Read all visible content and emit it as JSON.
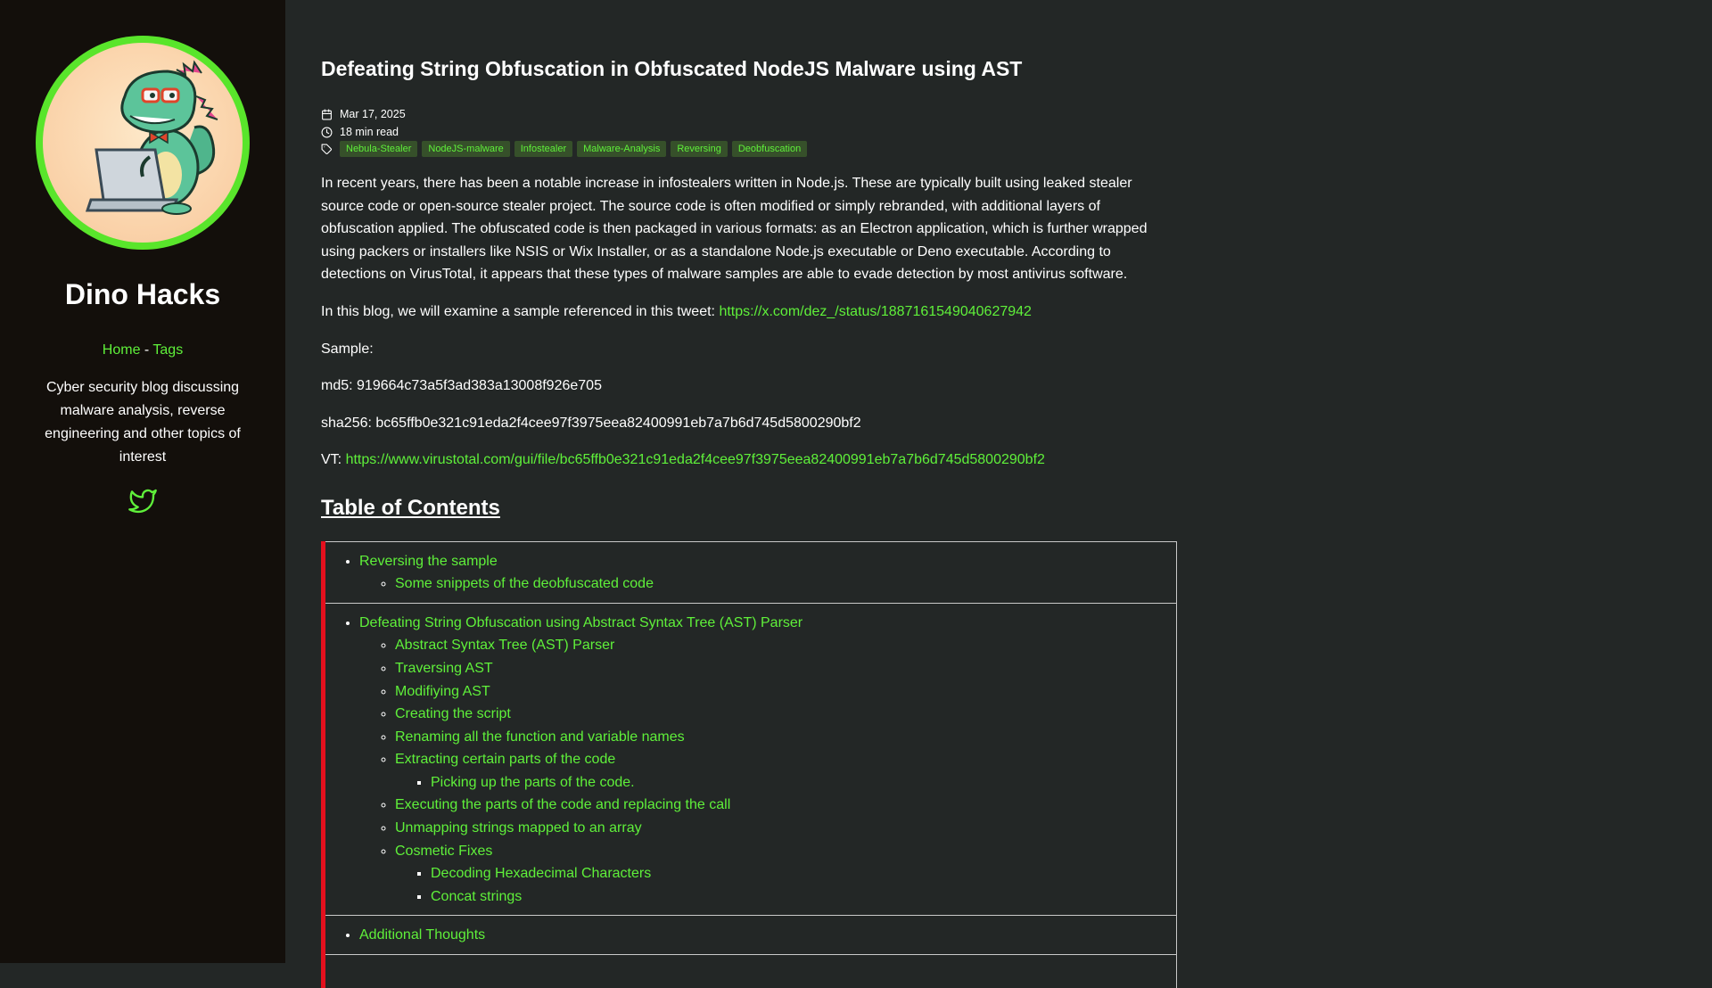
{
  "sidebar": {
    "site_title": "Dino Hacks",
    "nav": {
      "home": "Home",
      "separator": "-",
      "tags": "Tags"
    },
    "description": "Cyber security blog discussing malware analysis, reverse engineering and other topics of interest",
    "social_icon": "twitter-icon",
    "accent_color": "#5ff03a"
  },
  "post": {
    "title": "Defeating String Obfuscation in Obfuscated NodeJS Malware using AST",
    "date": "Mar 17, 2025",
    "read_time": "18 min read",
    "tags": [
      "Nebula-Stealer",
      "NodeJS-malware",
      "Infostealer",
      "Malware-Analysis",
      "Reversing",
      "Deobfuscation"
    ],
    "intro": "In recent years, there has been a notable increase in infostealers written in Node.js. These are typically built using leaked stealer source code or open-source stealer project. The source code is often modified or simply rebranded, with additional layers of obfuscation applied. The obfuscated code is then packaged in various formats: as an Electron application, which is further wrapped using packers or installers like NSIS or Wix Installer, or as a standalone Node.js executable or Deno executable. According to detections on VirusTotal, it appears that these types of malware samples are able to evade detection by most antivirus software.",
    "tweet_text": "In this blog, we will examine a sample referenced in this tweet:",
    "tweet_link": "https://x.com/dez_/status/1887161549040627942",
    "sample_label": "Sample:",
    "md5": "md5: 919664c73a5f3ad383a13008f926e705",
    "sha256": "sha256: bc65ffb0e321c91eda2f4cee97f3975eea82400991eb7a7b6d745d5800290bf2",
    "vt_label": "VT:",
    "vt_link": "https://www.virustotal.com/gui/file/bc65ffb0e321c91eda2f4cee97f3975eea82400991eb7a7b6d745d5800290bf2"
  },
  "toc": {
    "heading": "Table of Contents",
    "sections": [
      {
        "title": "Reversing the sample",
        "children": [
          {
            "title": "Some snippets of the deobfuscated code",
            "children": []
          }
        ]
      },
      {
        "title": "Defeating String Obfuscation using Abstract Syntax Tree (AST) Parser",
        "children": [
          {
            "title": "Abstract Syntax Tree (AST) Parser",
            "children": []
          },
          {
            "title": "Traversing AST",
            "children": []
          },
          {
            "title": "Modifiying AST",
            "children": []
          },
          {
            "title": "Creating the script",
            "children": []
          },
          {
            "title": "Renaming all the function and variable names",
            "children": []
          },
          {
            "title": "Extracting certain parts of the code",
            "children": [
              "Picking up the parts of the code."
            ]
          },
          {
            "title": "Executing the parts of the code and replacing the call",
            "children": []
          },
          {
            "title": "Unmapping strings mapped to an array",
            "children": []
          },
          {
            "title": "Cosmetic Fixes",
            "children": [
              "Decoding Hexadecimal Characters",
              "Concat strings"
            ]
          }
        ]
      },
      {
        "title": "Additional Thoughts",
        "children": []
      }
    ]
  }
}
